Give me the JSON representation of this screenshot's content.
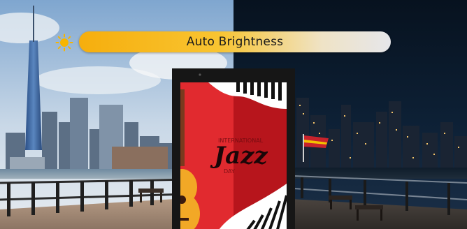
{
  "control": {
    "label": "Auto Brightness"
  },
  "icons": {
    "day": "sun-icon",
    "night": "moon-icon"
  },
  "poster": {
    "line1": "INTERNATIONAL",
    "word": "Jazz",
    "line2": "DAY"
  },
  "colors": {
    "accent": "#f6ae0d",
    "poster_red": "#e12a2f",
    "poster_dark_red": "#b7151c"
  }
}
